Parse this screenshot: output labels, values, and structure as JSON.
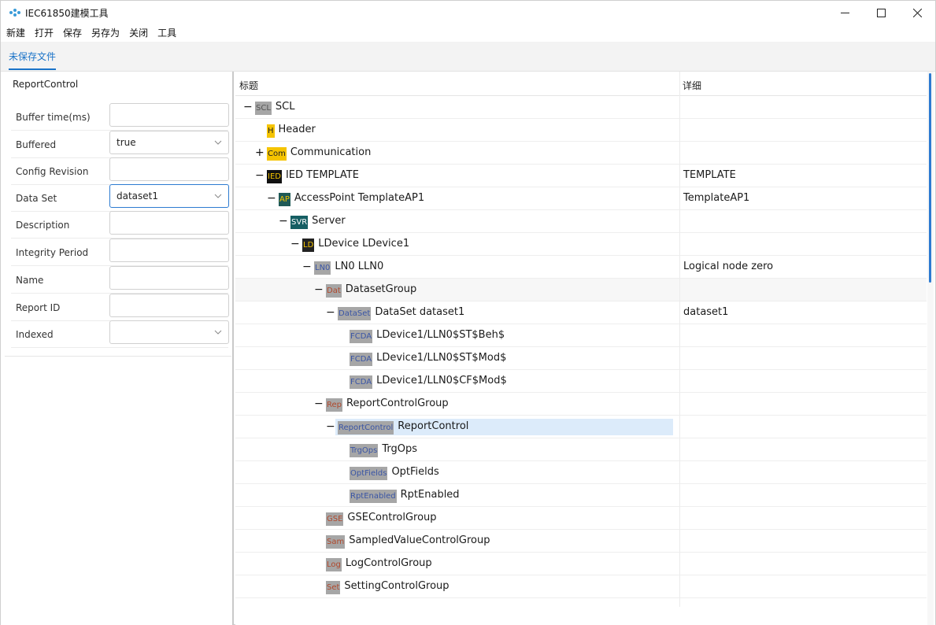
{
  "window": {
    "title": "IEC61850建模工具",
    "minimize_icon": "minimize-icon",
    "maximize_icon": "maximize-icon",
    "close_icon": "close-icon"
  },
  "menu": [
    "新建",
    "打开",
    "保存",
    "另存为",
    "关闭",
    "工具"
  ],
  "tabs": [
    {
      "label": "未保存文件",
      "active": true
    }
  ],
  "properties": {
    "title": "ReportControl",
    "rows": [
      {
        "label": "Buffer time(ms)",
        "value": "",
        "type": "text"
      },
      {
        "label": "Buffered",
        "value": "true",
        "type": "select"
      },
      {
        "label": "Config Revision",
        "value": "",
        "type": "text"
      },
      {
        "label": "Data Set",
        "value": "dataset1",
        "type": "select",
        "focused": true
      },
      {
        "label": "Description",
        "value": "",
        "type": "text"
      },
      {
        "label": "Integrity Period",
        "value": "",
        "type": "text"
      },
      {
        "label": "Name",
        "value": "",
        "type": "text"
      },
      {
        "label": "Report ID",
        "value": "",
        "type": "text"
      },
      {
        "label": "Indexed",
        "value": "",
        "type": "select"
      }
    ]
  },
  "tree": {
    "columns": {
      "title": "标题",
      "detail": "详细"
    },
    "rows": [
      {
        "depth": 0,
        "toggle": "−",
        "badge": "SCL",
        "badge_bg": "#a6a6a6",
        "badge_fg": "#555555",
        "label": "SCL",
        "detail": ""
      },
      {
        "depth": 1,
        "toggle": "",
        "badge": "H",
        "badge_bg": "#f5c400",
        "badge_fg": "#222222",
        "label": "Header",
        "detail": ""
      },
      {
        "depth": 1,
        "toggle": "+",
        "badge": "Com",
        "badge_bg": "#f5c400",
        "badge_fg": "#222222",
        "label": "Communication",
        "detail": ""
      },
      {
        "depth": 1,
        "toggle": "−",
        "badge": "IED",
        "badge_bg": "#111111",
        "badge_fg": "#f5c400",
        "label": "IED TEMPLATE",
        "detail": "TEMPLATE"
      },
      {
        "depth": 2,
        "toggle": "−",
        "badge": "AP",
        "badge_bg": "#1f5a57",
        "badge_fg": "#f5c400",
        "label": "AccessPoint TemplateAP1",
        "detail": "TemplateAP1"
      },
      {
        "depth": 3,
        "toggle": "−",
        "badge": "SVR",
        "badge_bg": "#155e63",
        "badge_fg": "#ffffff",
        "label": "Server",
        "detail": ""
      },
      {
        "depth": 4,
        "toggle": "−",
        "badge": "LD",
        "badge_bg": "#222222",
        "badge_fg": "#f5c400",
        "label": "LDevice LDevice1",
        "detail": ""
      },
      {
        "depth": 5,
        "toggle": "−",
        "badge": "LN0",
        "badge_bg": "#a6a6a6",
        "badge_fg": "#3a55a5",
        "label": "LN0 LLN0",
        "detail": "Logical node zero"
      },
      {
        "depth": 6,
        "toggle": "−",
        "badge": "Dat",
        "badge_bg": "#a6a6a6",
        "badge_fg": "#b0482c",
        "label": "DatasetGroup",
        "detail": "",
        "hover": true
      },
      {
        "depth": 7,
        "toggle": "−",
        "badge": "DataSet",
        "badge_bg": "#a6a6a6",
        "badge_fg": "#3a55a5",
        "label": "DataSet dataset1",
        "detail": "dataset1"
      },
      {
        "depth": 8,
        "toggle": "",
        "badge": "FCDA",
        "badge_bg": "#a6a6a6",
        "badge_fg": "#3a55a5",
        "label": "LDevice1/LLN0$ST$Beh$",
        "detail": ""
      },
      {
        "depth": 8,
        "toggle": "",
        "badge": "FCDA",
        "badge_bg": "#a6a6a6",
        "badge_fg": "#3a55a5",
        "label": "LDevice1/LLN0$ST$Mod$",
        "detail": ""
      },
      {
        "depth": 8,
        "toggle": "",
        "badge": "FCDA",
        "badge_bg": "#a6a6a6",
        "badge_fg": "#3a55a5",
        "label": "LDevice1/LLN0$CF$Mod$",
        "detail": ""
      },
      {
        "depth": 6,
        "toggle": "−",
        "badge": "Rep",
        "badge_bg": "#a6a6a6",
        "badge_fg": "#b0482c",
        "label": "ReportControlGroup",
        "detail": ""
      },
      {
        "depth": 7,
        "toggle": "−",
        "badge": "ReportControl",
        "badge_bg": "#a6a6a6",
        "badge_fg": "#3a55a5",
        "label": "ReportControl",
        "detail": "",
        "selected": true
      },
      {
        "depth": 8,
        "toggle": "",
        "badge": "TrgOps",
        "badge_bg": "#a6a6a6",
        "badge_fg": "#3a55a5",
        "label": "TrgOps",
        "detail": ""
      },
      {
        "depth": 8,
        "toggle": "",
        "badge": "OptFields",
        "badge_bg": "#a6a6a6",
        "badge_fg": "#3a55a5",
        "label": "OptFields",
        "detail": ""
      },
      {
        "depth": 8,
        "toggle": "",
        "badge": "RptEnabled",
        "badge_bg": "#a6a6a6",
        "badge_fg": "#3a55a5",
        "label": "RptEnabled",
        "detail": ""
      },
      {
        "depth": 6,
        "toggle": "",
        "badge": "GSE",
        "badge_bg": "#a6a6a6",
        "badge_fg": "#b0482c",
        "label": "GSEControlGroup",
        "detail": ""
      },
      {
        "depth": 6,
        "toggle": "",
        "badge": "Sam",
        "badge_bg": "#a6a6a6",
        "badge_fg": "#b0482c",
        "label": "SampledValueControlGroup",
        "detail": ""
      },
      {
        "depth": 6,
        "toggle": "",
        "badge": "Log",
        "badge_bg": "#a6a6a6",
        "badge_fg": "#b0482c",
        "label": "LogControlGroup",
        "detail": ""
      },
      {
        "depth": 6,
        "toggle": "",
        "badge": "Set",
        "badge_bg": "#a6a6a6",
        "badge_fg": "#b0482c",
        "label": "SettingControlGroup",
        "detail": ""
      }
    ]
  },
  "colors": {
    "accent": "#1a73c8",
    "selection": "#dcebfa",
    "scroll_thumb": "#2d7bd1"
  }
}
